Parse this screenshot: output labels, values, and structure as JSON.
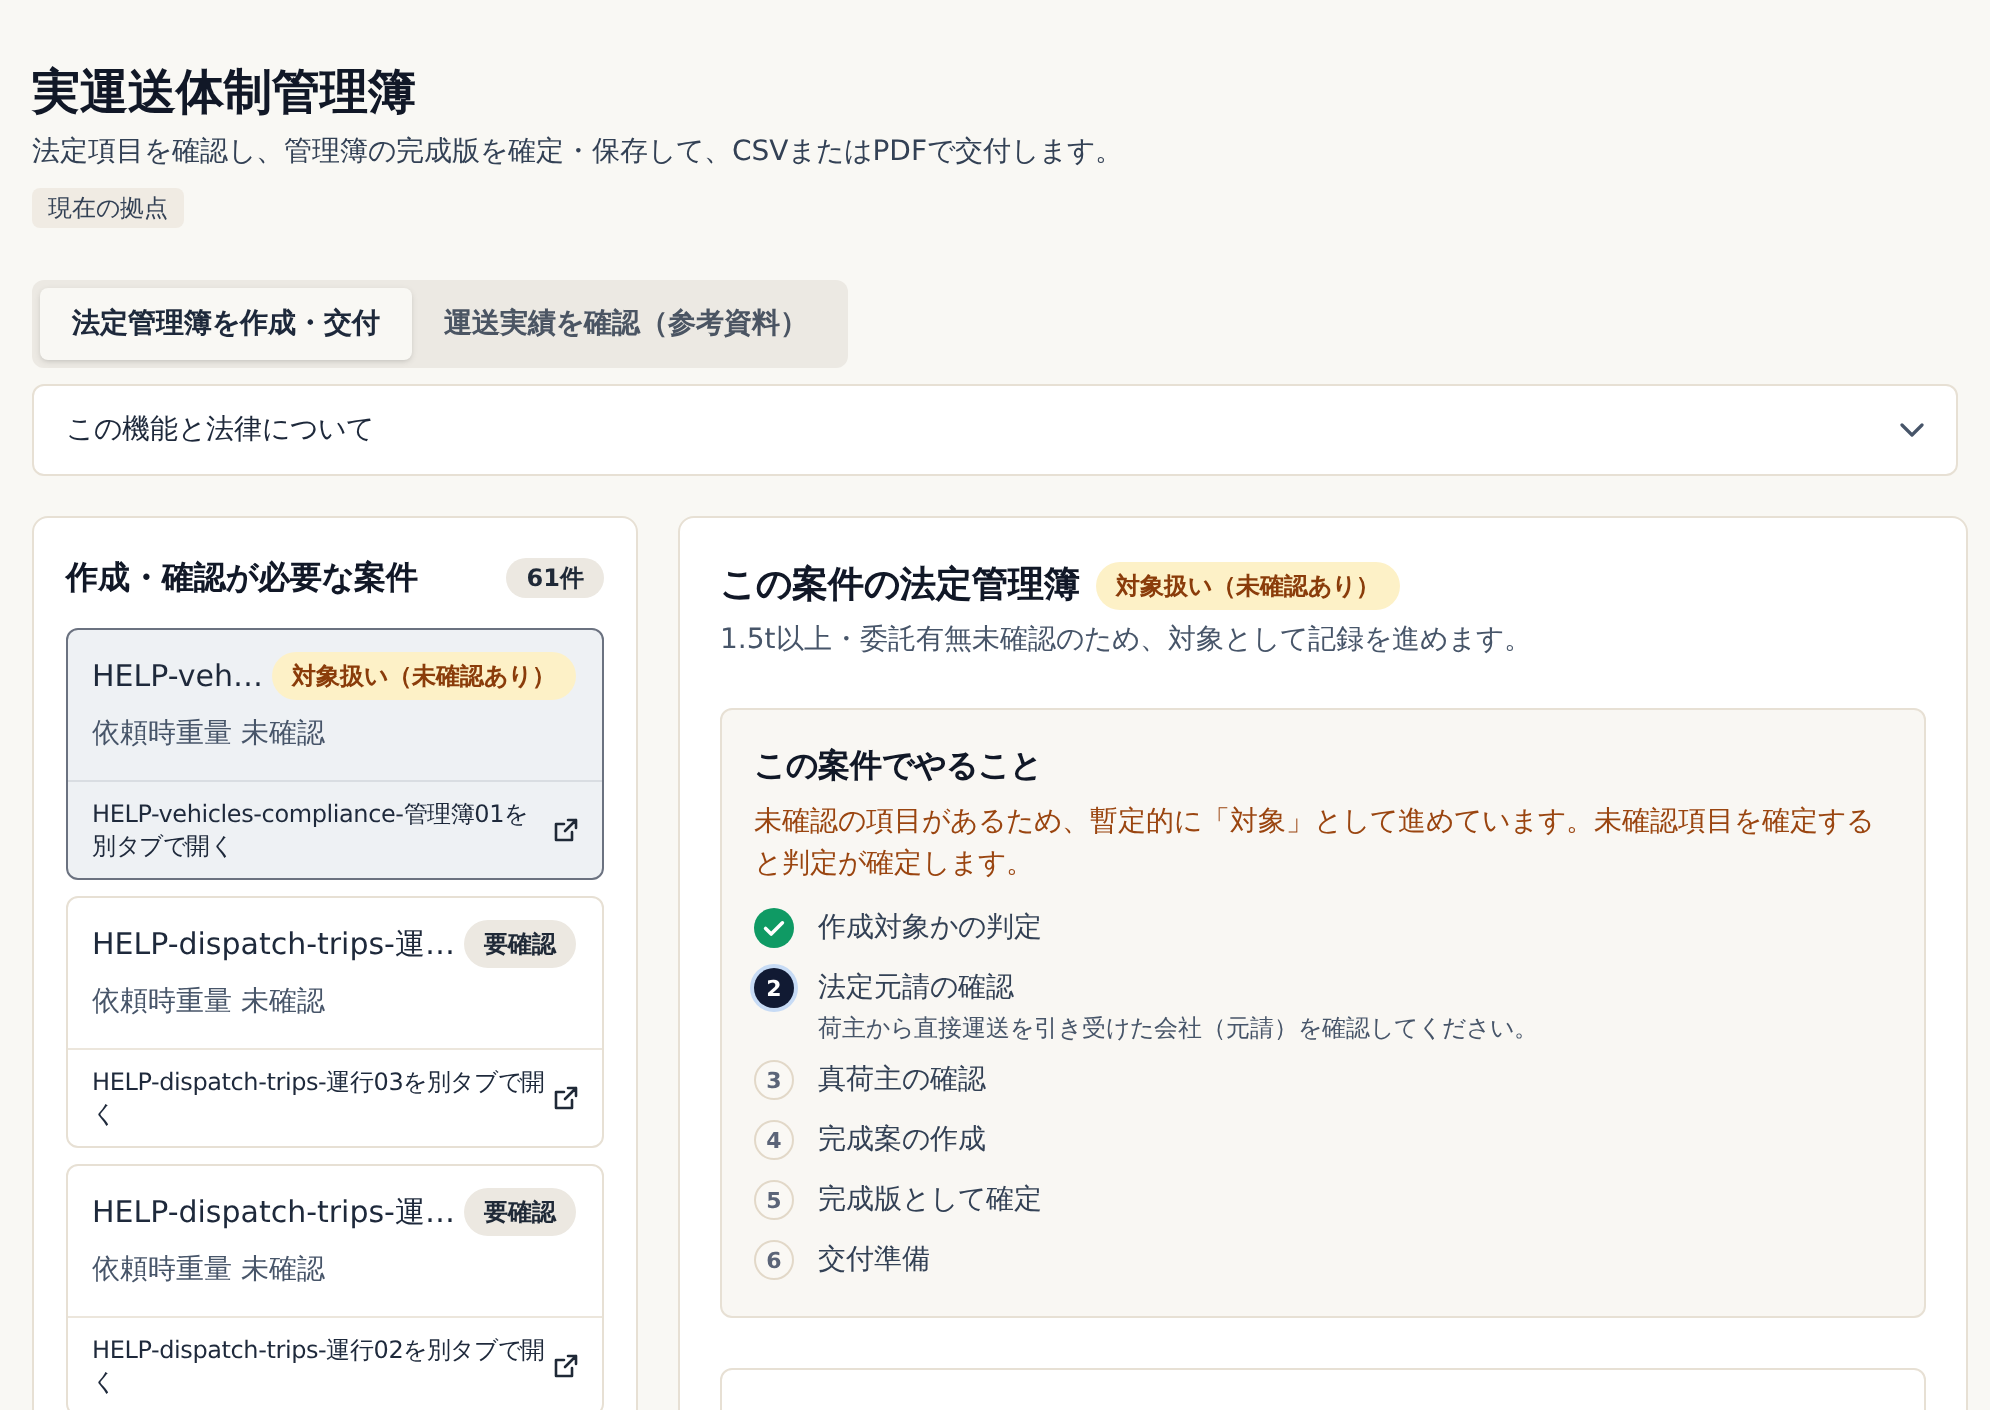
{
  "page": {
    "title": "実運送体制管理簿",
    "subtitle": "法定項目を確認し、管理簿の完成版を確定・保存して、CSVまたはPDFで交付します。",
    "location_badge": "現在の拠点"
  },
  "tabs": [
    {
      "label": "法定管理簿を作成・交付",
      "selected": true
    },
    {
      "label": "運送実績を確認（参考資料）",
      "selected": false
    }
  ],
  "accordion": {
    "label": "この機能と法律について",
    "expanded": false
  },
  "case_list": {
    "title": "作成・確認が必要な案件",
    "count": "61件",
    "items": [
      {
        "title": "HELP-veh…",
        "badge": {
          "text": "対象扱い（未確認あり）",
          "kind": "warning"
        },
        "weight": "依頼時重量 未確認",
        "link": "HELP-vehicles-compliance-管理簿01を別タブで開く",
        "selected": true
      },
      {
        "title": "HELP-dispatch-trips-運…",
        "badge": {
          "text": "要確認",
          "kind": "neutral"
        },
        "weight": "依頼時重量 未確認",
        "link": "HELP-dispatch-trips-運行03を別タブで開く",
        "selected": false
      },
      {
        "title": "HELP-dispatch-trips-運…",
        "badge": {
          "text": "要確認",
          "kind": "neutral"
        },
        "weight": "依頼時重量 未確認",
        "link": "HELP-dispatch-trips-運行02を別タブで開く",
        "selected": false
      }
    ]
  },
  "detail": {
    "title": "この案件の法定管理簿",
    "badge": {
      "text": "対象扱い（未確認あり）",
      "kind": "warning"
    },
    "description": "1.5t以上・委託有無未確認のため、対象として記録を進めます。",
    "todo": {
      "title": "この案件でやること",
      "note": "未確認の項目があるため、暫定的に「対象」として進めています。未確認項目を確定すると判定が確定します。",
      "steps": [
        {
          "kind": "done",
          "label": "作成対象かの判定"
        },
        {
          "kind": "current",
          "number": "2",
          "label": "法定元請の確認",
          "hint": "荷主から直接運送を引き受けた会社（元請）を確認してください。"
        },
        {
          "kind": "todo",
          "number": "3",
          "label": "真荷主の確認"
        },
        {
          "kind": "todo",
          "number": "4",
          "label": "完成案の作成"
        },
        {
          "kind": "todo",
          "number": "5",
          "label": "完成版として確定"
        },
        {
          "kind": "todo",
          "number": "6",
          "label": "交付準備"
        }
      ]
    }
  }
}
